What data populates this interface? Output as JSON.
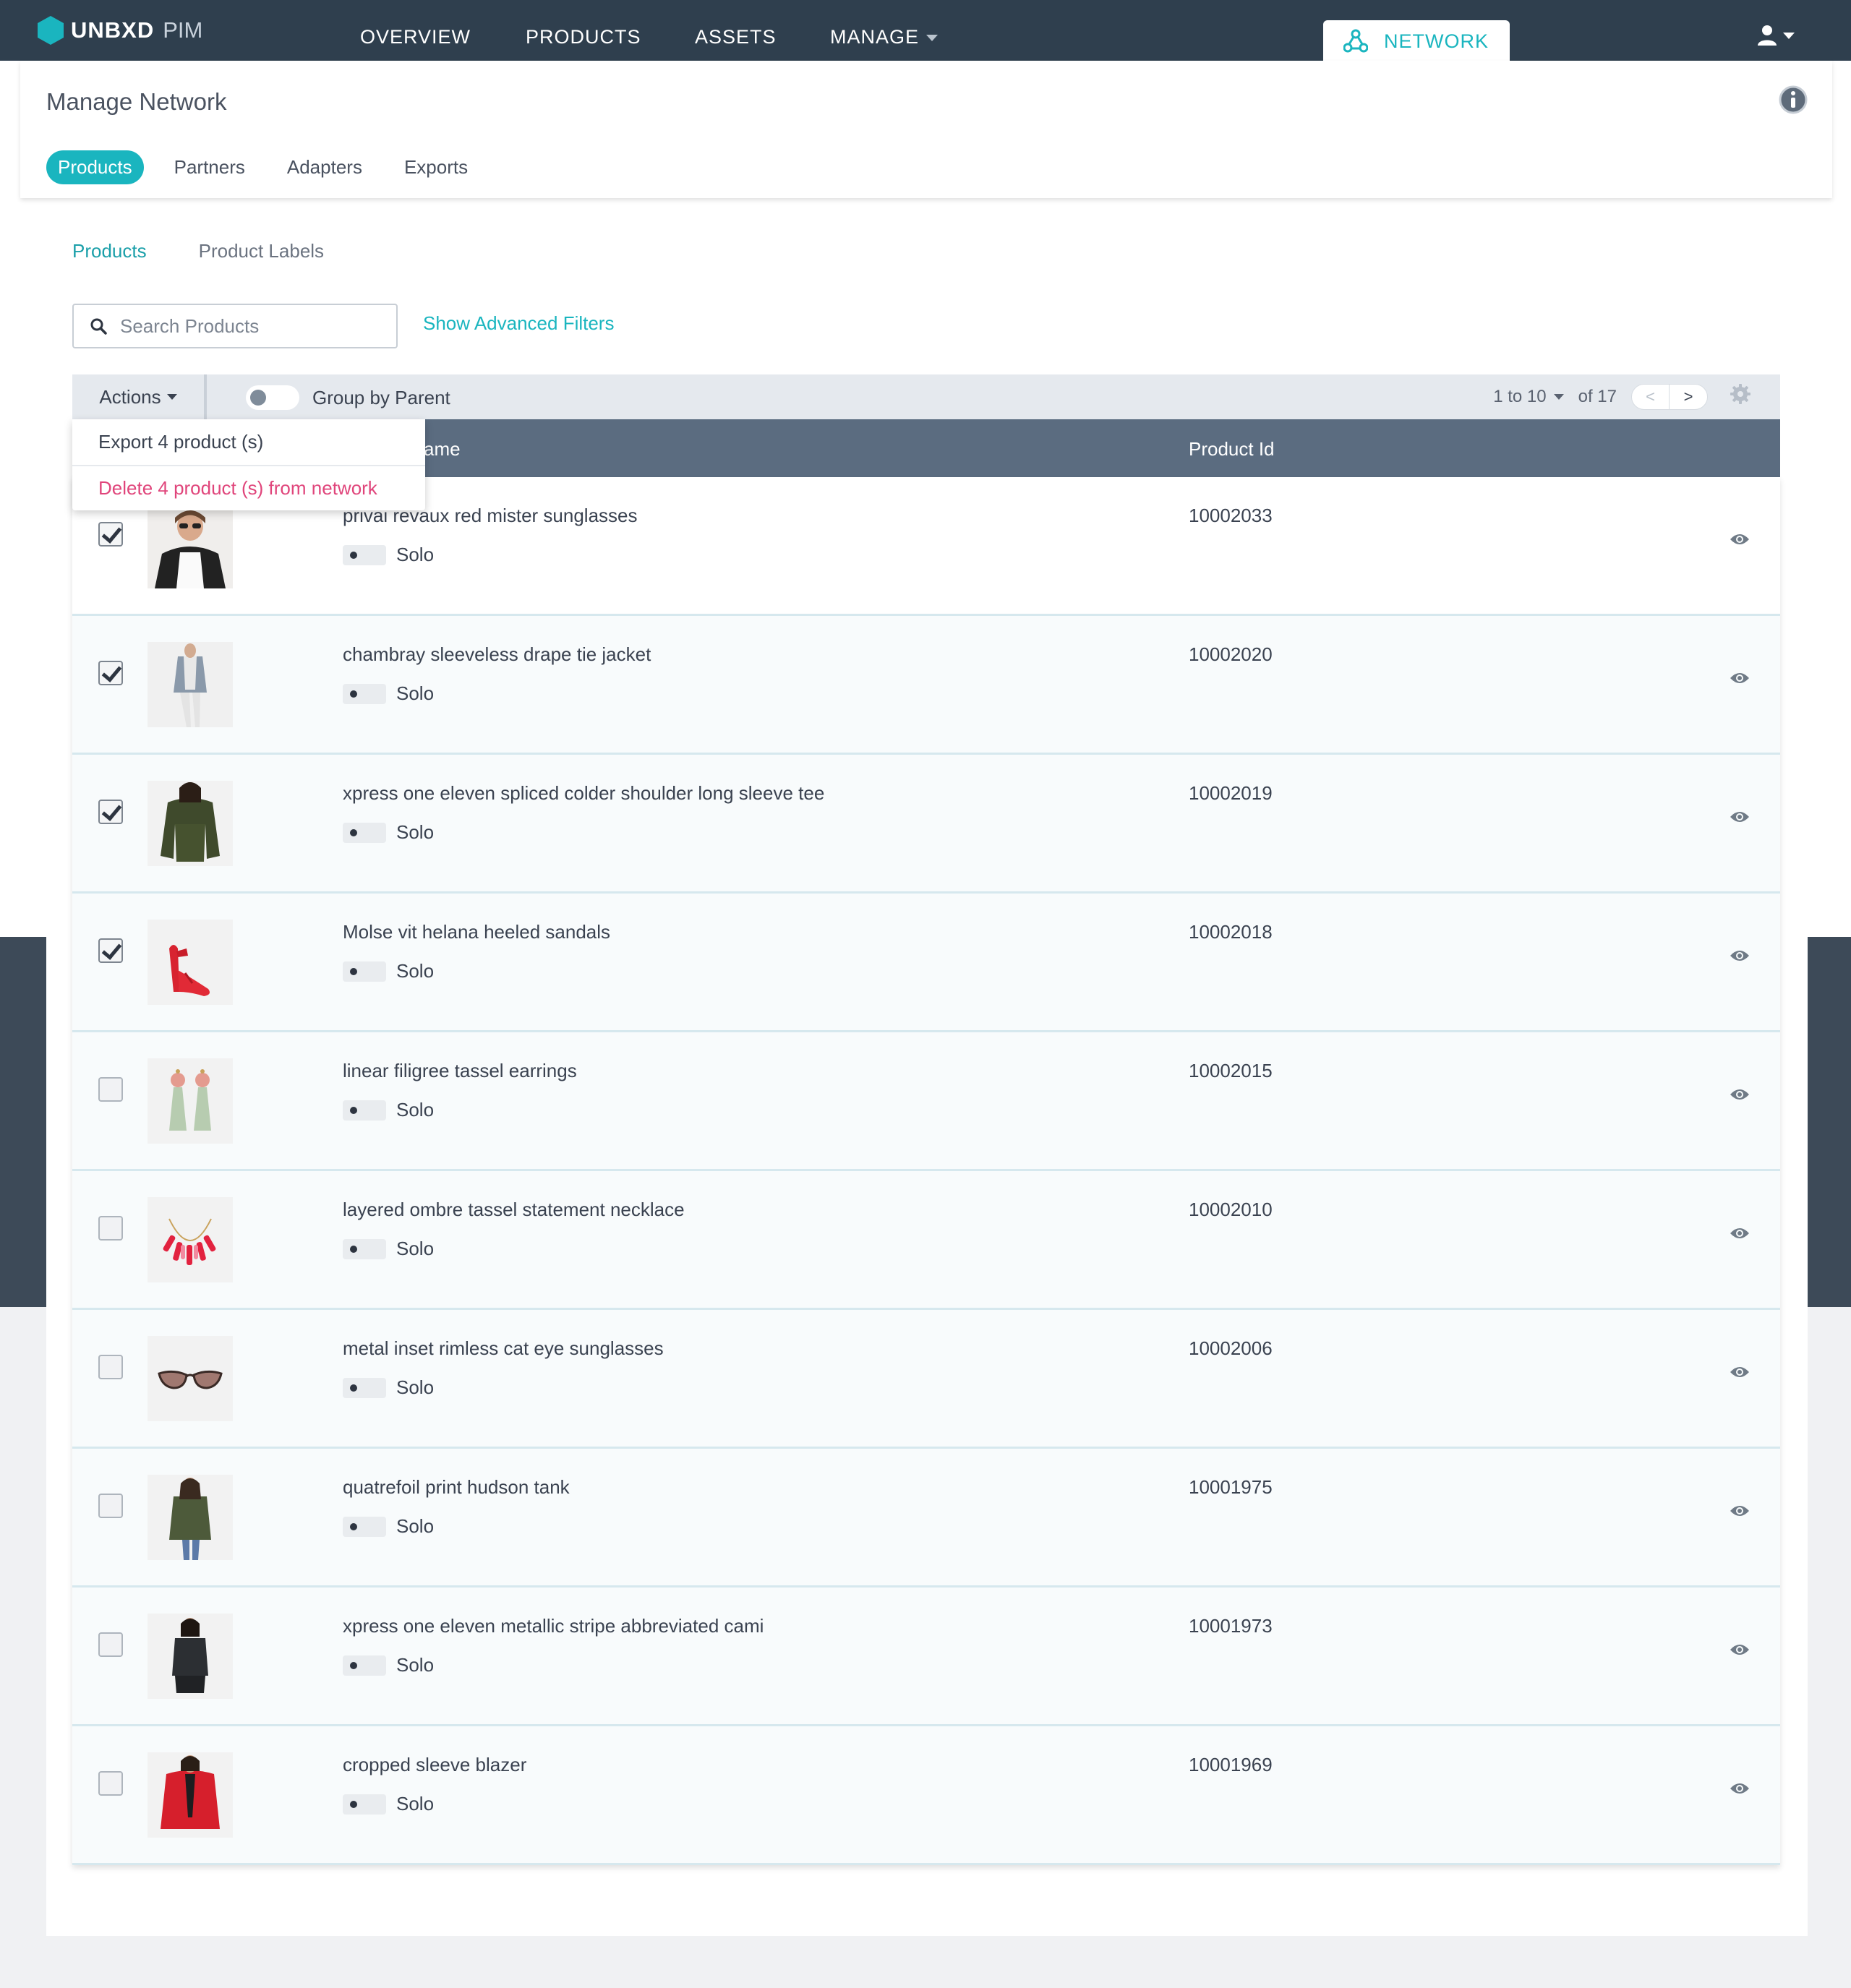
{
  "app": {
    "brand": "UNBXD",
    "product": "PIM"
  },
  "nav": {
    "items": [
      "OVERVIEW",
      "PRODUCTS",
      "ASSETS",
      "MANAGE"
    ],
    "network": "NETWORK"
  },
  "page": {
    "title": "Manage Network",
    "subnav": [
      "Products",
      "Partners",
      "Adapters",
      "Exports"
    ]
  },
  "tabs": [
    "Products",
    "Product Labels"
  ],
  "search": {
    "placeholder": "Search Products",
    "value": ""
  },
  "advanced_filters": "Show Advanced Filters",
  "toolbar": {
    "actions": "Actions",
    "group_by_parent": "Group by Parent",
    "range": "1 to 10",
    "of": "of 17",
    "prev": "<",
    "next": ">"
  },
  "dropdown": {
    "export": "Export 4 product (s)",
    "delete": "Delete 4 product (s) from network"
  },
  "table": {
    "col_name": "ame",
    "col_id": "Product Id",
    "rows": [
      {
        "name": "privai revaux red mister sunglasses",
        "type": "Solo",
        "id": "10002033",
        "checked": true
      },
      {
        "name": "chambray sleeveless drape tie jacket",
        "type": "Solo",
        "id": "10002020",
        "checked": true
      },
      {
        "name": "xpress one eleven spliced colder shoulder long sleeve tee",
        "type": "Solo",
        "id": "10002019",
        "checked": true
      },
      {
        "name": "Molse vit helana heeled sandals",
        "type": "Solo",
        "id": "10002018",
        "checked": true
      },
      {
        "name": "linear filigree tassel earrings",
        "type": "Solo",
        "id": "10002015",
        "checked": false
      },
      {
        "name": "layered ombre tassel statement necklace",
        "type": "Solo",
        "id": "10002010",
        "checked": false
      },
      {
        "name": "metal inset rimless cat eye sunglasses",
        "type": "Solo",
        "id": "10002006",
        "checked": false
      },
      {
        "name": "quatrefoil print hudson tank",
        "type": "Solo",
        "id": "10001975",
        "checked": false
      },
      {
        "name": "xpress one eleven metallic stripe abbreviated cami",
        "type": "Solo",
        "id": "10001973",
        "checked": false
      },
      {
        "name": "cropped sleeve blazer",
        "type": "Solo",
        "id": "10001969",
        "checked": false
      }
    ]
  },
  "colors": {
    "accent": "#1ab5bf",
    "nav_bg": "#2f3f4e",
    "table_header": "#5b6c80",
    "danger": "#e0457b"
  }
}
